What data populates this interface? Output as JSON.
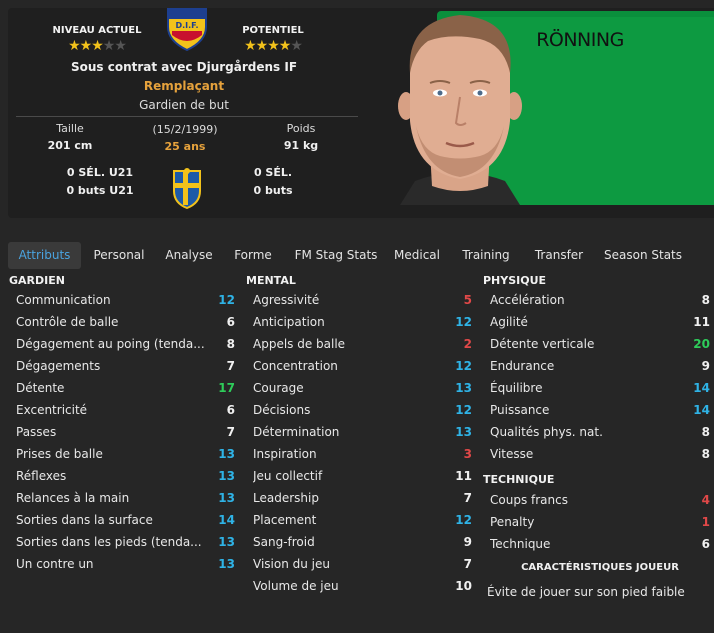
{
  "header": {
    "current_level_label": "NIVEAU ACTUEL",
    "current_stars": 2.5,
    "potential_label": "POTENTIEL",
    "potential_stars": 4,
    "club_logo_text": "D.I.F.",
    "contract": "Sous contrat avec Djurgårdens IF",
    "status": "Remplaçant",
    "position": "Gardien de but",
    "height_label": "Taille",
    "height_value": "201 cm",
    "dob_label": "(15/2/1999)",
    "age_value": "25 ans",
    "weight_label": "Poids",
    "weight_value": "91 kg",
    "caps_u21": "0 SÉL. U21",
    "goals_u21": "0 buts U21",
    "caps": "0 SÉL.",
    "goals": "0 buts",
    "player_name": "RÖNNING"
  },
  "colors": {
    "accent": "#4aa3df",
    "status_orange": "#e6a23c",
    "star": "#f2c21b",
    "kit_green": "#0d9a41"
  },
  "tabs": [
    {
      "label": "Attributs",
      "active": true
    },
    {
      "label": "Personal"
    },
    {
      "label": "Analyse"
    },
    {
      "label": "Forme"
    },
    {
      "label": "FM Stag Stats"
    },
    {
      "label": "Medical"
    },
    {
      "label": "Training"
    },
    {
      "label": "Transfer"
    },
    {
      "label": "Season Stats"
    }
  ],
  "sections": {
    "gardien": {
      "title": "GARDIEN",
      "items": [
        {
          "name": "Communication",
          "value": "12",
          "color": "cyan"
        },
        {
          "name": "Contrôle de balle",
          "value": "6",
          "color": "white"
        },
        {
          "name": "Dégagement au poing (tenda...",
          "value": "8",
          "color": "white"
        },
        {
          "name": "Dégagements",
          "value": "7",
          "color": "white"
        },
        {
          "name": "Détente",
          "value": "17",
          "color": "green"
        },
        {
          "name": "Excentricité",
          "value": "6",
          "color": "white"
        },
        {
          "name": "Passes",
          "value": "7",
          "color": "white"
        },
        {
          "name": "Prises de balle",
          "value": "13",
          "color": "cyan"
        },
        {
          "name": "Réflexes",
          "value": "13",
          "color": "cyan"
        },
        {
          "name": "Relances à la main",
          "value": "13",
          "color": "cyan"
        },
        {
          "name": "Sorties dans la surface",
          "value": "14",
          "color": "cyan"
        },
        {
          "name": "Sorties dans les pieds (tenda...",
          "value": "13",
          "color": "cyan"
        },
        {
          "name": "Un contre un",
          "value": "13",
          "color": "cyan"
        }
      ]
    },
    "mental": {
      "title": "MENTAL",
      "items": [
        {
          "name": "Agressivité",
          "value": "5",
          "color": "red"
        },
        {
          "name": "Anticipation",
          "value": "12",
          "color": "cyan"
        },
        {
          "name": "Appels de balle",
          "value": "2",
          "color": "red"
        },
        {
          "name": "Concentration",
          "value": "12",
          "color": "cyan"
        },
        {
          "name": "Courage",
          "value": "13",
          "color": "cyan"
        },
        {
          "name": "Décisions",
          "value": "12",
          "color": "cyan"
        },
        {
          "name": "Détermination",
          "value": "13",
          "color": "cyan"
        },
        {
          "name": "Inspiration",
          "value": "3",
          "color": "red"
        },
        {
          "name": "Jeu collectif",
          "value": "11",
          "color": "white"
        },
        {
          "name": "Leadership",
          "value": "7",
          "color": "white"
        },
        {
          "name": "Placement",
          "value": "12",
          "color": "cyan"
        },
        {
          "name": "Sang-froid",
          "value": "9",
          "color": "white"
        },
        {
          "name": "Vision du jeu",
          "value": "7",
          "color": "white"
        },
        {
          "name": "Volume de jeu",
          "value": "10",
          "color": "white"
        }
      ]
    },
    "physique": {
      "title": "PHYSIQUE",
      "items": [
        {
          "name": "Accélération",
          "value": "8",
          "color": "white"
        },
        {
          "name": "Agilité",
          "value": "11",
          "color": "white"
        },
        {
          "name": "Détente verticale",
          "value": "20",
          "color": "green"
        },
        {
          "name": "Endurance",
          "value": "9",
          "color": "white"
        },
        {
          "name": "Équilibre",
          "value": "14",
          "color": "cyan"
        },
        {
          "name": "Puissance",
          "value": "14",
          "color": "cyan"
        },
        {
          "name": "Qualités phys. nat.",
          "value": "8",
          "color": "white"
        },
        {
          "name": "Vitesse",
          "value": "8",
          "color": "white"
        }
      ]
    },
    "technique": {
      "title": "TECHNIQUE",
      "items": [
        {
          "name": "Coups francs",
          "value": "4",
          "color": "red"
        },
        {
          "name": "Penalty",
          "value": "1",
          "color": "red"
        },
        {
          "name": "Technique",
          "value": "6",
          "color": "white"
        }
      ]
    },
    "traits": {
      "title": "CARACTÉRISTIQUES JOUEUR",
      "text": "Évite de jouer sur son pied faible"
    }
  }
}
